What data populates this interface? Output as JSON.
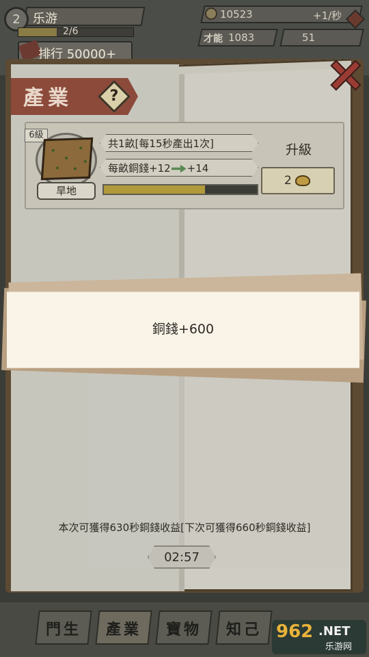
{
  "player": {
    "level": "2",
    "name": "乐游",
    "exp_text": "2/6",
    "exp_progress": 0.33,
    "rank_text": "排行 50000+"
  },
  "resources": {
    "coins": "10523",
    "coin_rate": "+1/秒",
    "talent": "1083",
    "talent_label": "才能",
    "troops": "51"
  },
  "panel": {
    "title": "產業",
    "help_symbol": "?"
  },
  "industry": {
    "level_tag": "6級",
    "name": "旱地",
    "acres_info": "共1畝[每15秒產出1次]",
    "yield_prefix": "每畝銅錢+12",
    "yield_next": "+14",
    "progress": 0.66,
    "upgrade_label": "升級",
    "upgrade_cost": "2",
    "cost_icon": "ingot-icon"
  },
  "toast": {
    "message": "銅錢+600"
  },
  "earnings": {
    "text": "本次可獲得630秒銅錢收益[下次可獲得660秒銅錢收益]",
    "timer": "02:57"
  },
  "tabs": [
    {
      "label": "門生"
    },
    {
      "label": "產業"
    },
    {
      "label": "寶物"
    },
    {
      "label": "知己"
    }
  ],
  "watermark": {
    "logo": "962",
    "net": ".NET",
    "sub": "乐游网"
  },
  "colors": {
    "accent_banner": "#8c4a3a",
    "progress_fill": "#b19a3a",
    "toast_bg": "#faf4e8"
  }
}
